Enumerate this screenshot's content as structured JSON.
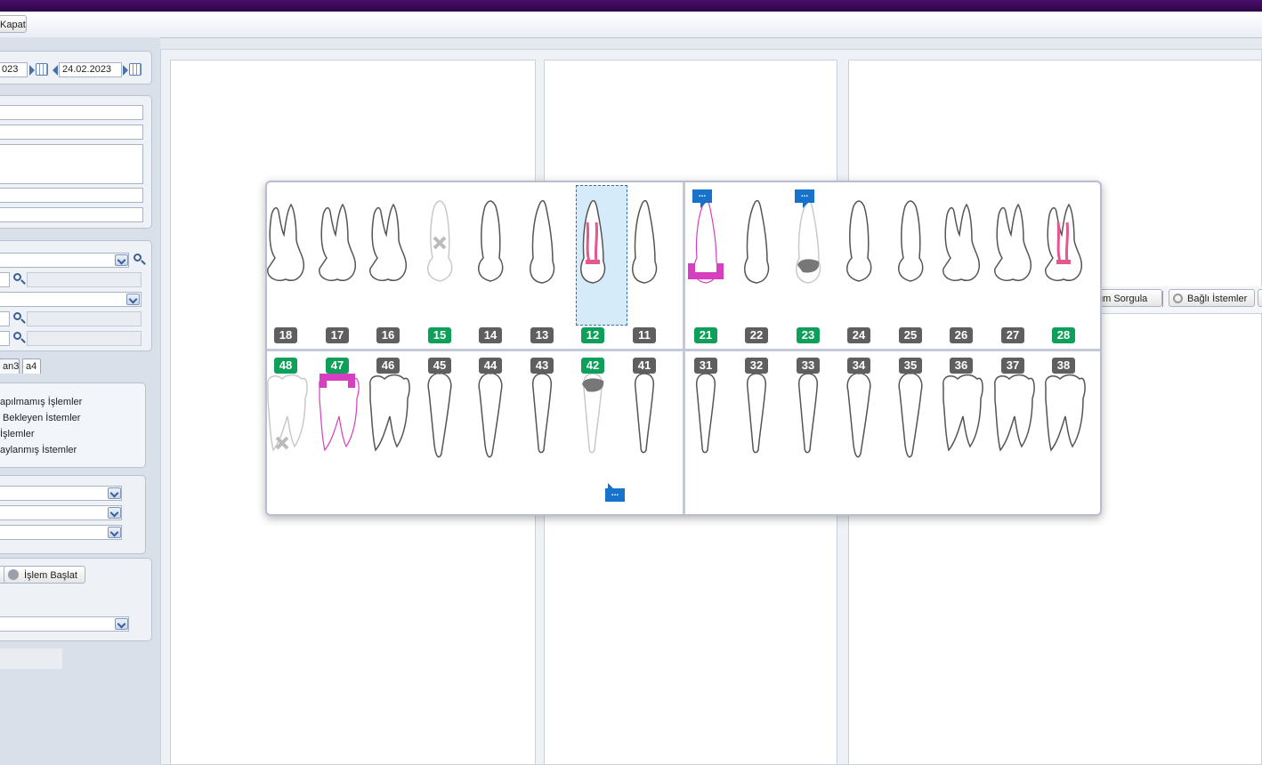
{
  "toolbar": {
    "close_label": "Kapat"
  },
  "filters": {
    "start_date": "023",
    "end_date": "24.02.2023"
  },
  "tabs": [
    "an3",
    "a4"
  ],
  "status_list": [
    "apılmamış İşlemler",
    "Bekleyen İstemler",
    "İşlemler",
    "aylanmış İstemler"
  ],
  "actions": {
    "start_label": "İşlem Başlat"
  },
  "right_toolbar": {
    "query_label": "um Sorgula",
    "linked_label": "Bağlı İstemler"
  },
  "dental_chart": {
    "upper_right": [
      {
        "number": "18",
        "status": "normal"
      },
      {
        "number": "17",
        "status": "normal"
      },
      {
        "number": "16",
        "status": "normal"
      },
      {
        "number": "15",
        "status": "green"
      },
      {
        "number": "14",
        "status": "normal"
      },
      {
        "number": "13",
        "status": "normal"
      },
      {
        "number": "12",
        "status": "green"
      },
      {
        "number": "11",
        "status": "normal"
      }
    ],
    "upper_left": [
      {
        "number": "21",
        "status": "green"
      },
      {
        "number": "22",
        "status": "normal"
      },
      {
        "number": "23",
        "status": "green"
      },
      {
        "number": "24",
        "status": "normal"
      },
      {
        "number": "25",
        "status": "normal"
      },
      {
        "number": "26",
        "status": "normal"
      },
      {
        "number": "27",
        "status": "normal"
      },
      {
        "number": "28",
        "status": "green"
      }
    ],
    "lower_right": [
      {
        "number": "48",
        "status": "green"
      },
      {
        "number": "47",
        "status": "green"
      },
      {
        "number": "46",
        "status": "normal"
      },
      {
        "number": "45",
        "status": "normal"
      },
      {
        "number": "44",
        "status": "normal"
      },
      {
        "number": "43",
        "status": "normal"
      },
      {
        "number": "42",
        "status": "green"
      },
      {
        "number": "41",
        "status": "normal"
      }
    ],
    "lower_left": [
      {
        "number": "31",
        "status": "normal"
      },
      {
        "number": "32",
        "status": "normal"
      },
      {
        "number": "33",
        "status": "normal"
      },
      {
        "number": "34",
        "status": "normal"
      },
      {
        "number": "35",
        "status": "normal"
      },
      {
        "number": "36",
        "status": "normal"
      },
      {
        "number": "37",
        "status": "normal"
      },
      {
        "number": "38",
        "status": "normal"
      }
    ],
    "selected_tooth": "12",
    "note_marker": "...",
    "colors": {
      "normal": "#5f5f5f",
      "green": "#0e9f5b",
      "treatment": "#d63fc0",
      "canal": "#e5578f",
      "caries": "#777777",
      "note": "#1673c9"
    }
  }
}
